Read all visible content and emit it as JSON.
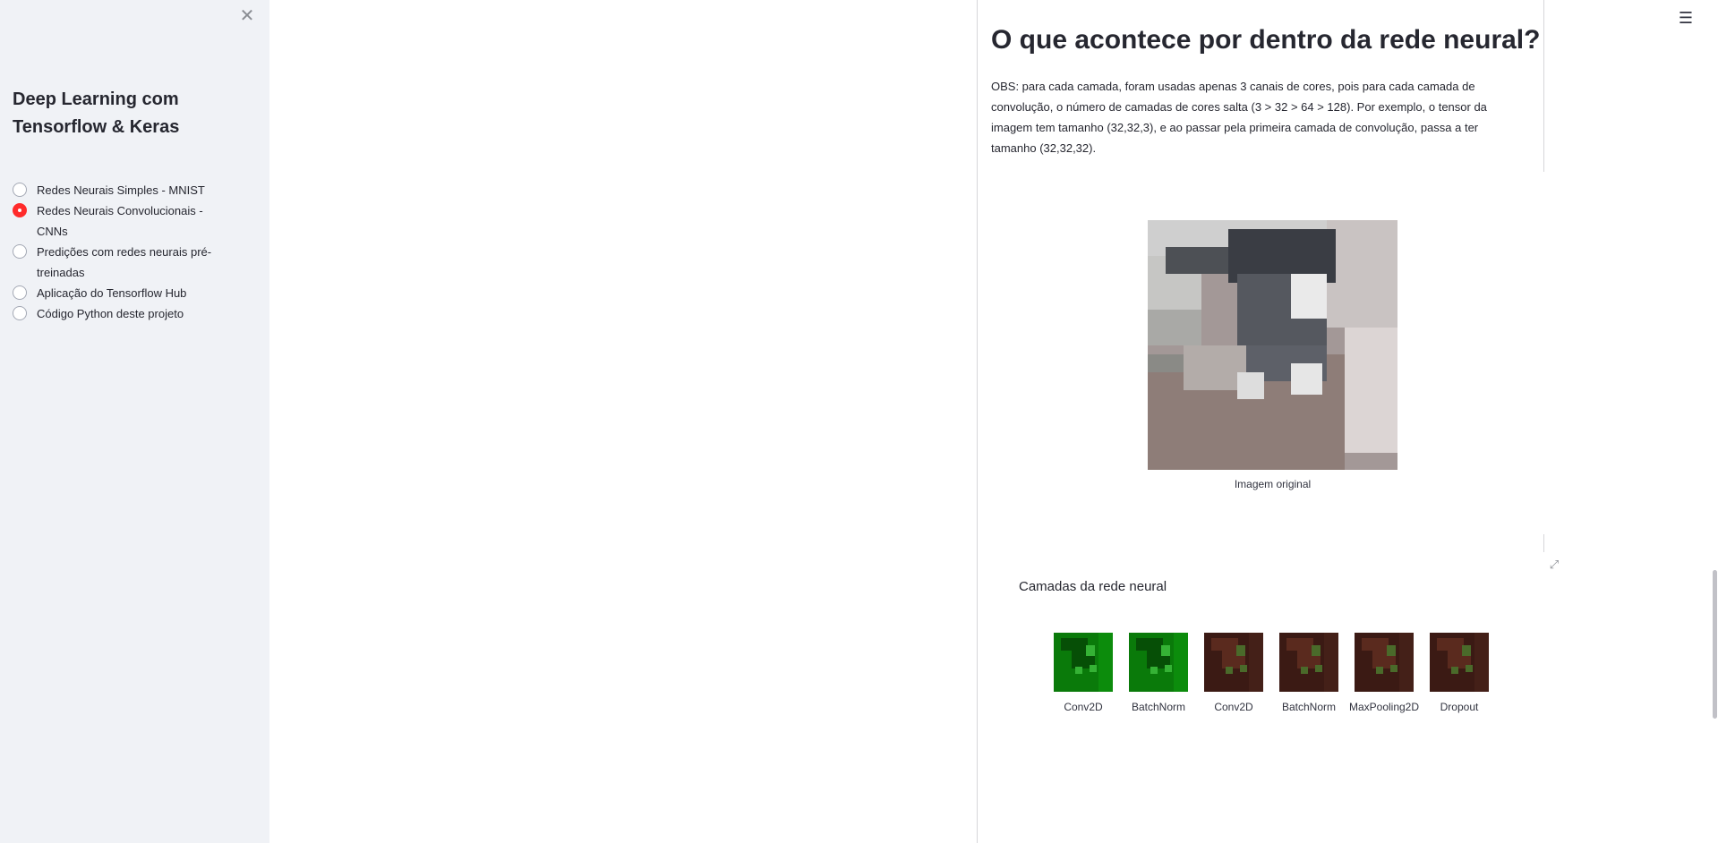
{
  "sidebar": {
    "title": "Deep Learning com Tensorflow & Keras",
    "close_icon": "close-icon",
    "nav_options": [
      {
        "label": "Redes Neurais Simples - MNIST",
        "selected": false
      },
      {
        "label": "Redes Neurais Convolucionais - CNNs",
        "selected": true
      },
      {
        "label": "Predições com redes neurais pré-treinadas",
        "selected": false
      },
      {
        "label": "Aplicação do Tensorflow Hub",
        "selected": false
      },
      {
        "label": "Código Python deste projeto",
        "selected": false
      }
    ]
  },
  "header": {
    "menu_icon": "hamburger-menu-icon"
  },
  "main": {
    "title": "O que acontece por dentro da rede neural?",
    "obs_text": "OBS: para cada camada, foram usadas apenas 3 canais de cores, pois para cada camada de convolução, o número de camadas de cores salta (3 > 32 > 64 > 128). Por exemplo, o tensor da imagem tem tamanho (32,32,3), e ao passar pela primeira camada de convolução, passa a ter tamanho (32,32,32).",
    "original_image_caption": "Imagem original",
    "expand_icon": "fullscreen-expand-icon",
    "layers_title": "Camadas da rede neural",
    "layers": [
      {
        "caption": "Conv2D",
        "tint": "green"
      },
      {
        "caption": "BatchNorm",
        "tint": "green"
      },
      {
        "caption": "Conv2D",
        "tint": "dark-red-green"
      },
      {
        "caption": "BatchNorm",
        "tint": "dark-red-green"
      },
      {
        "caption": "MaxPooling2D",
        "tint": "dark-red-green"
      },
      {
        "caption": "Dropout",
        "tint": "dark-red-green"
      }
    ]
  },
  "colors": {
    "sidebar_bg": "#f0f2f6",
    "accent": "#ff2b2b",
    "text": "#262730"
  }
}
